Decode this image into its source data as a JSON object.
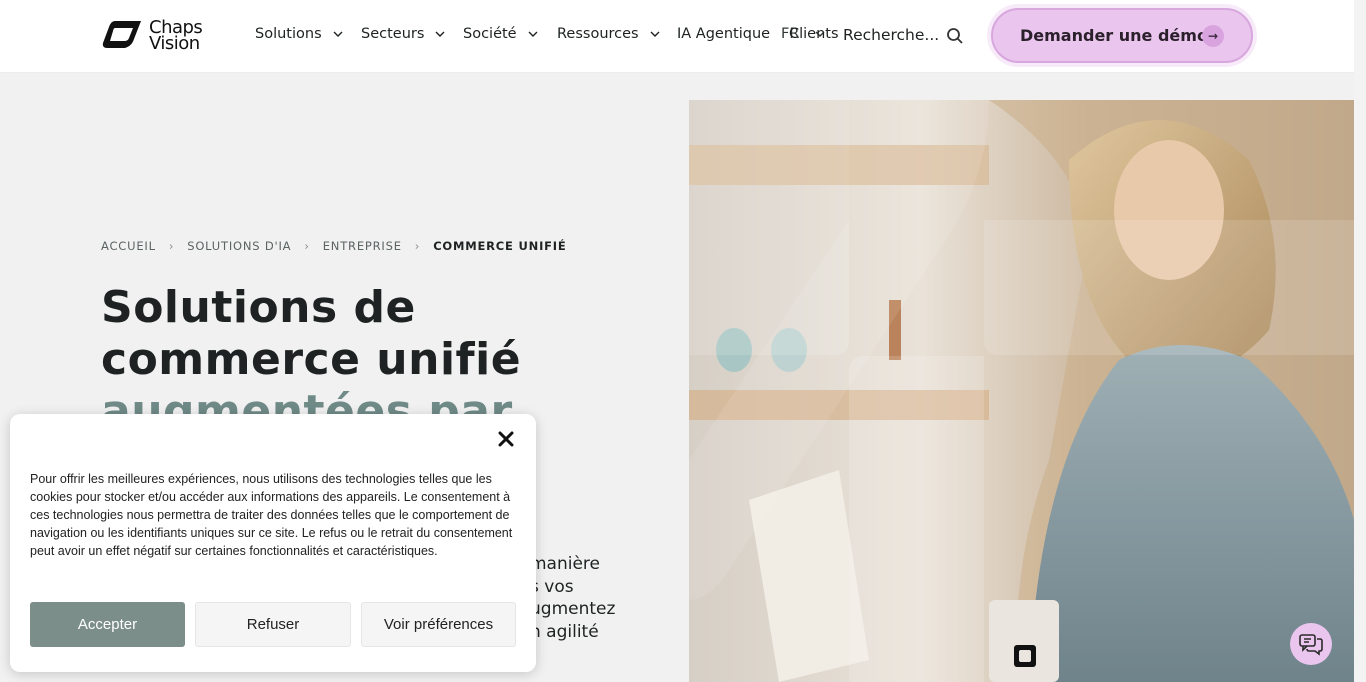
{
  "header": {
    "logo_line1": "Chaps",
    "logo_line2": "Vision",
    "nav": [
      {
        "label": "Solutions",
        "has_dropdown": true
      },
      {
        "label": "Secteurs",
        "has_dropdown": true
      },
      {
        "label": "Société",
        "has_dropdown": true
      },
      {
        "label": "Ressources",
        "has_dropdown": true
      },
      {
        "label": "IA Agentique",
        "has_dropdown": false
      },
      {
        "label": "Clients",
        "has_dropdown": false
      }
    ],
    "language": "FR",
    "search_placeholder": "Recherche...",
    "demo_button": "Demander une démo",
    "demo_arrow": "→"
  },
  "breadcrumb": {
    "items": [
      "ACCUEIL",
      "SOLUTIONS D'IA",
      "ENTREPRISE",
      "COMMERCE UNIFIÉ"
    ]
  },
  "hero": {
    "title_line1": "Solutions de",
    "title_line2": "commerce unifié",
    "title_line3": "augmentées par",
    "lead_lines": [
      "manière",
      "s vos",
      "ugmentez",
      "n agilité"
    ]
  },
  "cookie_banner": {
    "text": "Pour offrir les meilleures expériences, nous utilisons des technologies telles que les cookies pour stocker et/ou accéder aux informations des appareils. Le consentement à ces technologies nous permettra de traiter des données telles que le comportement de navigation ou les identifiants uniques sur ce site. Le refus ou le retrait du consentement peut avoir un effet négatif sur certaines fonctionnalités et caractéristiques.",
    "accept": "Accepter",
    "refuse": "Refuser",
    "preferences": "Voir préférences"
  },
  "colors": {
    "accent_pink": "#eac6ee",
    "accept_green": "#7b8e8a",
    "title_accent": "#6f8a87"
  }
}
